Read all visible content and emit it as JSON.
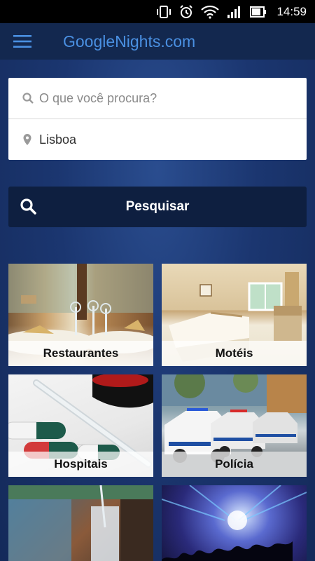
{
  "status_bar": {
    "time": "14:59"
  },
  "app_bar": {
    "title": "GoogleNights.com"
  },
  "search": {
    "query_placeholder": "O que você procura?",
    "query_value": "",
    "location_value": "Lisboa"
  },
  "search_button": {
    "label": "Pesquisar"
  },
  "categories": [
    {
      "label": "Restaurantes"
    },
    {
      "label": "Motéis"
    },
    {
      "label": "Hospitais"
    },
    {
      "label": "Polícia"
    },
    {
      "label": ""
    },
    {
      "label": ""
    }
  ],
  "colors": {
    "title_blue": "#4a90e2",
    "app_bar": "#13284f",
    "button_dark": "#0e1f40"
  }
}
